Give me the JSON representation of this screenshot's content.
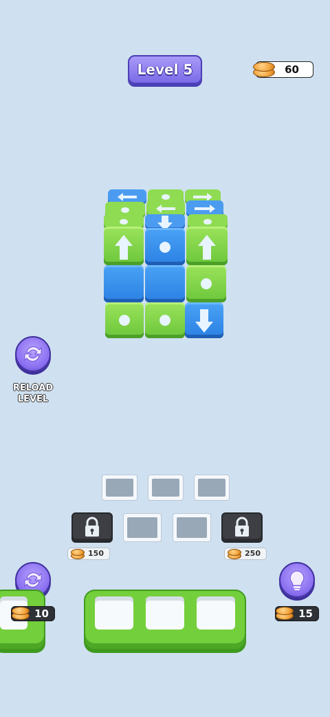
{
  "header": {
    "level_label": "Level 5",
    "coins": "60"
  },
  "left_panel": {
    "reload_label_line1": "RELOAD",
    "reload_label_line2": "LEVEL"
  },
  "slots": {
    "lock_left_price": "150",
    "lock_right_price": "250"
  },
  "bottom": {
    "shuffle_cost": "10",
    "hint_cost": "15"
  },
  "colors": {
    "background": "#cfe0f0",
    "green_block": "#7fd446",
    "blue_block": "#3a92ee",
    "purple_button": "#8a6ff0"
  },
  "icons": {
    "reload": "reload-icon",
    "shuffle": "shuffle-icon",
    "hint": "lightbulb-icon",
    "lock": "lock-icon",
    "coin": "coin-icon"
  }
}
